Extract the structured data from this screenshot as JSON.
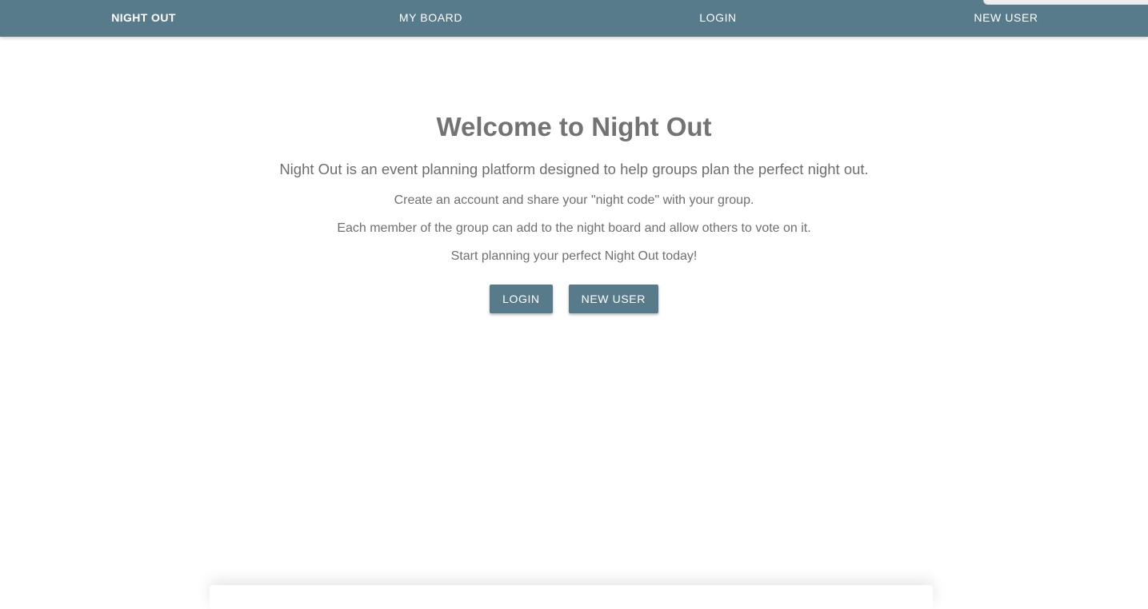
{
  "nav": {
    "brand": "NIGHT OUT",
    "items": [
      {
        "label": "MY BOARD"
      },
      {
        "label": "LOGIN"
      },
      {
        "label": "NEW USER"
      }
    ]
  },
  "hero": {
    "title": "Welcome to Night Out",
    "subtitle": "Night Out is an event planning platform designed to help groups plan the perfect night out.",
    "lines": [
      "Create an account and share your \"night code\" with your group.",
      "Each member of the group can add to the night board and allow others to vote on it.",
      "Start planning your perfect Night Out today!"
    ]
  },
  "actions": {
    "login_label": "LOGIN",
    "new_user_label": "NEW USER"
  },
  "colors": {
    "primary": "#587b8b",
    "text": "#757575",
    "background": "#ffffff"
  }
}
